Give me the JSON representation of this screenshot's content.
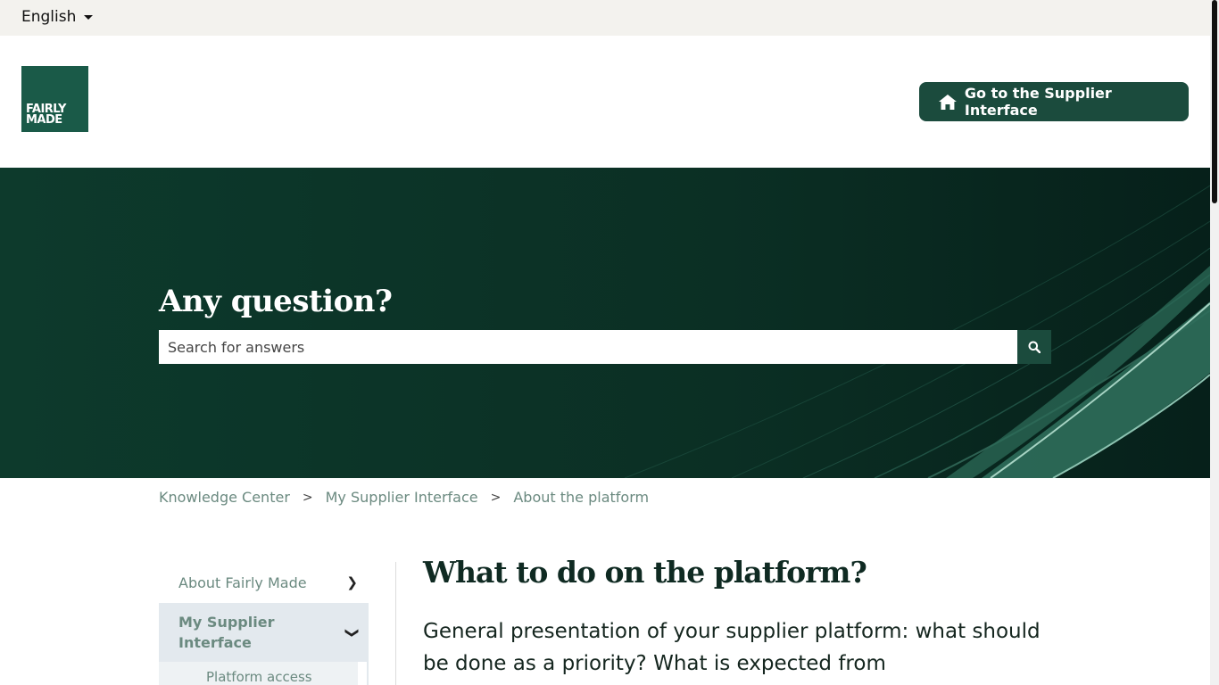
{
  "topbar": {
    "language": "English"
  },
  "header": {
    "logo_text": "FAIRLY\nMADE",
    "cta_label": "Go to the Supplier Interface"
  },
  "hero": {
    "title": "Any question?",
    "search_placeholder": "Search for answers"
  },
  "breadcrumb": [
    {
      "label": "Knowledge Center"
    },
    {
      "label": "My Supplier Interface"
    },
    {
      "label": "About the platform"
    }
  ],
  "breadcrumb_separator": ">",
  "sidebar": {
    "items": [
      {
        "label": "About Fairly Made",
        "chevron": "❯"
      },
      {
        "label": "My Supplier Interface",
        "chevron": "❯"
      }
    ],
    "sub_items": [
      {
        "label": "Platform access"
      }
    ]
  },
  "article": {
    "title": "What to do on the platform?",
    "lead": "General presentation of your supplier platform: what should be done as a priority? What is expected from"
  },
  "colors": {
    "brand_green": "#1a5a48",
    "dark_green": "#1b4b3d",
    "hero_bg": "#0c3326",
    "muted_link": "#6b8a80"
  }
}
